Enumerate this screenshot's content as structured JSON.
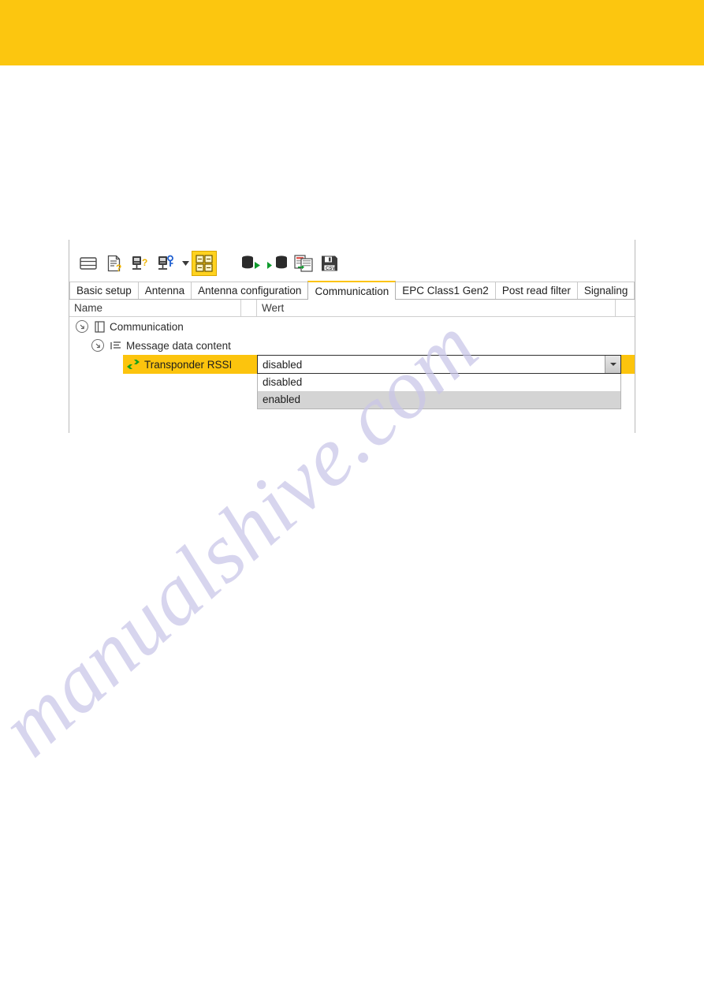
{
  "page": {
    "brand_color": "#fcc60f",
    "accent_color": "#fcc40d",
    "watermark_text": "manualshive.com"
  },
  "toolbar": {
    "buttons": [
      {
        "name": "device-list-icon",
        "label": "Device list"
      },
      {
        "name": "document-question-icon",
        "label": "Read device description"
      },
      {
        "name": "device-question-icon",
        "label": "Device identification"
      },
      {
        "name": "device-key-icon",
        "label": "Device login"
      },
      {
        "name": "dropdown-caret-icon",
        "label": "More"
      },
      {
        "name": "parameter-grid-icon",
        "label": "Parameters",
        "active": true
      },
      {
        "name": "read-from-device-icon",
        "label": "Read from device"
      },
      {
        "name": "write-to-device-icon",
        "label": "Write to device"
      },
      {
        "name": "copy-parameters-icon",
        "label": "Copy parameters"
      },
      {
        "name": "save-csv-icon",
        "label": "Save as CSV"
      }
    ]
  },
  "tabs": {
    "items": [
      {
        "label": "Basic setup",
        "active": false
      },
      {
        "label": "Antenna",
        "active": false
      },
      {
        "label": "Antenna configuration",
        "active": false
      },
      {
        "label": "Communication",
        "active": true
      },
      {
        "label": "EPC Class1 Gen2",
        "active": false
      },
      {
        "label": "Post read filter",
        "active": false
      },
      {
        "label": "Signaling",
        "active": false
      }
    ]
  },
  "grid": {
    "headers": {
      "name": "Name",
      "spacer": "",
      "value": "Wert",
      "tail": ""
    },
    "rows": [
      {
        "label": "Communication",
        "icon": "book-icon",
        "level": 0,
        "expanded": true,
        "selected": false
      },
      {
        "label": "Message data content",
        "icon": "list-icon",
        "level": 1,
        "expanded": true,
        "selected": false
      },
      {
        "label": "Transponder RSSI",
        "icon": "exchange-arrows-icon",
        "level": 2,
        "expanded": false,
        "selected": true
      }
    ]
  },
  "combo": {
    "value": "disabled",
    "options": [
      {
        "label": "disabled",
        "highlighted": false
      },
      {
        "label": "enabled",
        "highlighted": true
      }
    ]
  }
}
